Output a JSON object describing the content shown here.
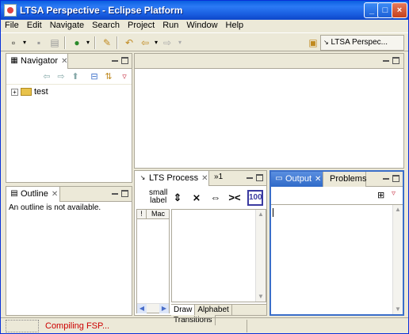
{
  "window": {
    "title": "LTSA Perspective - Eclipse Platform"
  },
  "menu": [
    "File",
    "Edit",
    "Navigate",
    "Search",
    "Project",
    "Run",
    "Window",
    "Help"
  ],
  "toolbar": {
    "perspective_label": "LTSA Perspec..."
  },
  "navigator": {
    "tab_label": "Navigator",
    "tree": [
      {
        "label": "test"
      }
    ]
  },
  "outline": {
    "tab_label": "Outline",
    "message": "An outline is not available."
  },
  "lts": {
    "tab_label": "LTS Process",
    "overflow_label": "1",
    "small_label_line1": "small",
    "small_label_line2": "label",
    "table_header_bang": "!",
    "table_header_mach": "Mac",
    "tabs": [
      "Draw",
      "Alphabet",
      "Transitions"
    ],
    "zoom_label": "100"
  },
  "output": {
    "tab_label": "Output",
    "problems_label": "Problems"
  },
  "status": {
    "text": "Compiling FSP..."
  }
}
